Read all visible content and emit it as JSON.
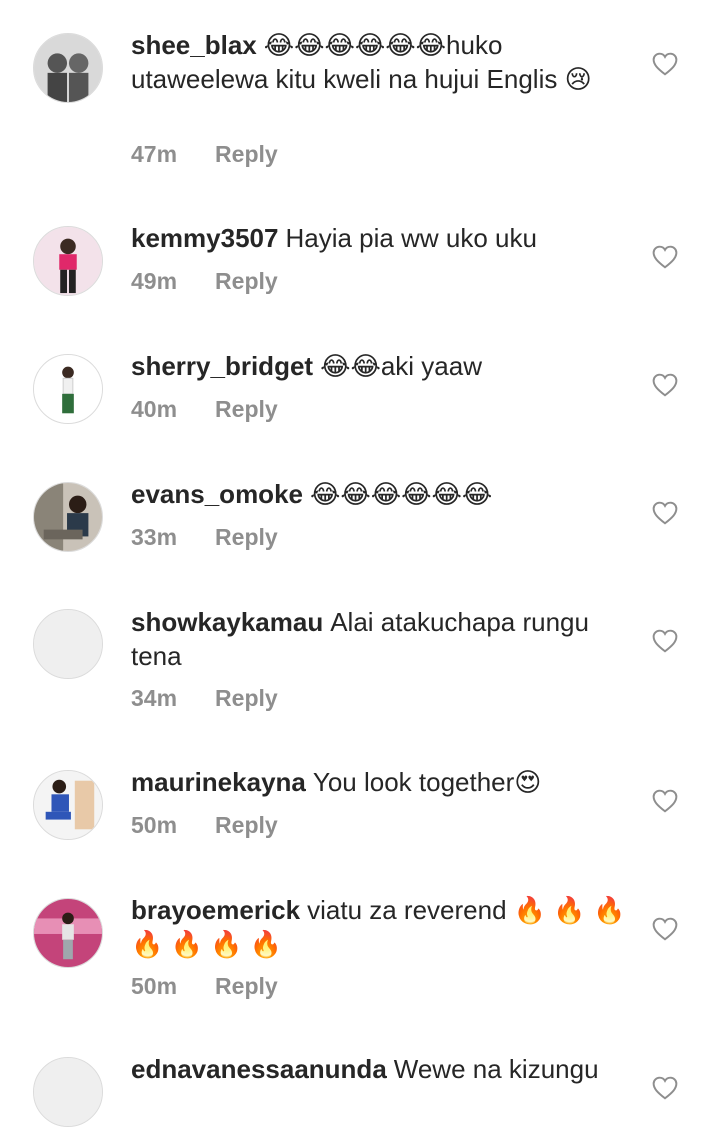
{
  "comments": [
    {
      "username": "shee_blax",
      "text": "😂😂😂😂😂😂huko utaweelewa kitu kweli na hujui Englis 😢",
      "time": "47m",
      "reply": "Reply"
    },
    {
      "username": "kemmy3507",
      "text": "Hayia pia ww uko uku",
      "time": "49m",
      "reply": "Reply"
    },
    {
      "username": "sherry_bridget",
      "text": "😂😂aki yaaw",
      "time": "40m",
      "reply": "Reply"
    },
    {
      "username": "evans_omoke",
      "text": "😂😂😂😂😂😂",
      "time": "33m",
      "reply": "Reply"
    },
    {
      "username": "showkaykamau",
      "text": "Alai atakuchapa rungu tena",
      "time": "34m",
      "reply": "Reply"
    },
    {
      "username": "maurinekayna",
      "text": "You look together😍",
      "time": "50m",
      "reply": "Reply"
    },
    {
      "username": "brayoemerick",
      "text": "viatu za reverend 🔥 🔥 🔥 🔥 🔥 🔥 🔥",
      "time": "50m",
      "reply": "Reply"
    },
    {
      "username": "ednavanessaanunda",
      "text": "Wewe na kizungu",
      "time": "",
      "reply": ""
    }
  ],
  "icons": {
    "like": "heart-outline-icon"
  },
  "colors": {
    "text": "#262626",
    "meta": "#8e8e8e",
    "avatar_placeholder": "#efefef"
  }
}
